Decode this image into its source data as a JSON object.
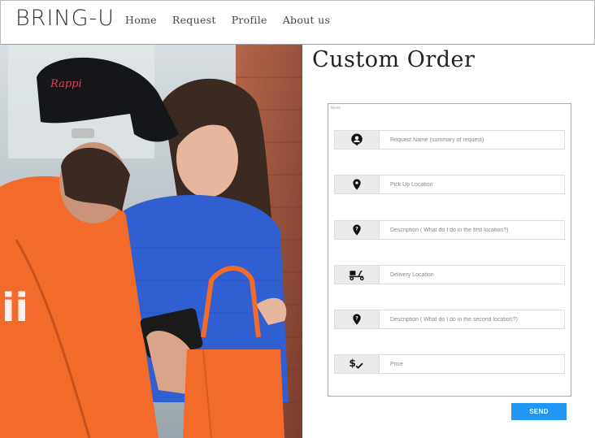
{
  "brand": "BRING-U",
  "nav": {
    "items": [
      "Home",
      "Request",
      "Profile",
      "About us"
    ]
  },
  "page": {
    "title": "Custom Order"
  },
  "form": {
    "legend": "Name",
    "fields": [
      {
        "icon": "user-pin-icon",
        "placeholder": "Request Name (summary of request)"
      },
      {
        "icon": "location-pin-icon",
        "placeholder": "Pick Up Location"
      },
      {
        "icon": "question-pin-icon",
        "placeholder": "Description ( What do I do in the first location?)"
      },
      {
        "icon": "scooter-icon",
        "placeholder": "Delivery Location"
      },
      {
        "icon": "question-pin-icon",
        "placeholder": "Description ( What do I do in the second location?)"
      },
      {
        "icon": "price-check-icon",
        "placeholder": "Price"
      }
    ],
    "submit_label": "SEND"
  },
  "hero_image": {
    "logo_text": "Rappi"
  },
  "colors": {
    "accent": "#2196f3",
    "jacket": "#f26b2a",
    "sweater": "#2f5fd0"
  }
}
